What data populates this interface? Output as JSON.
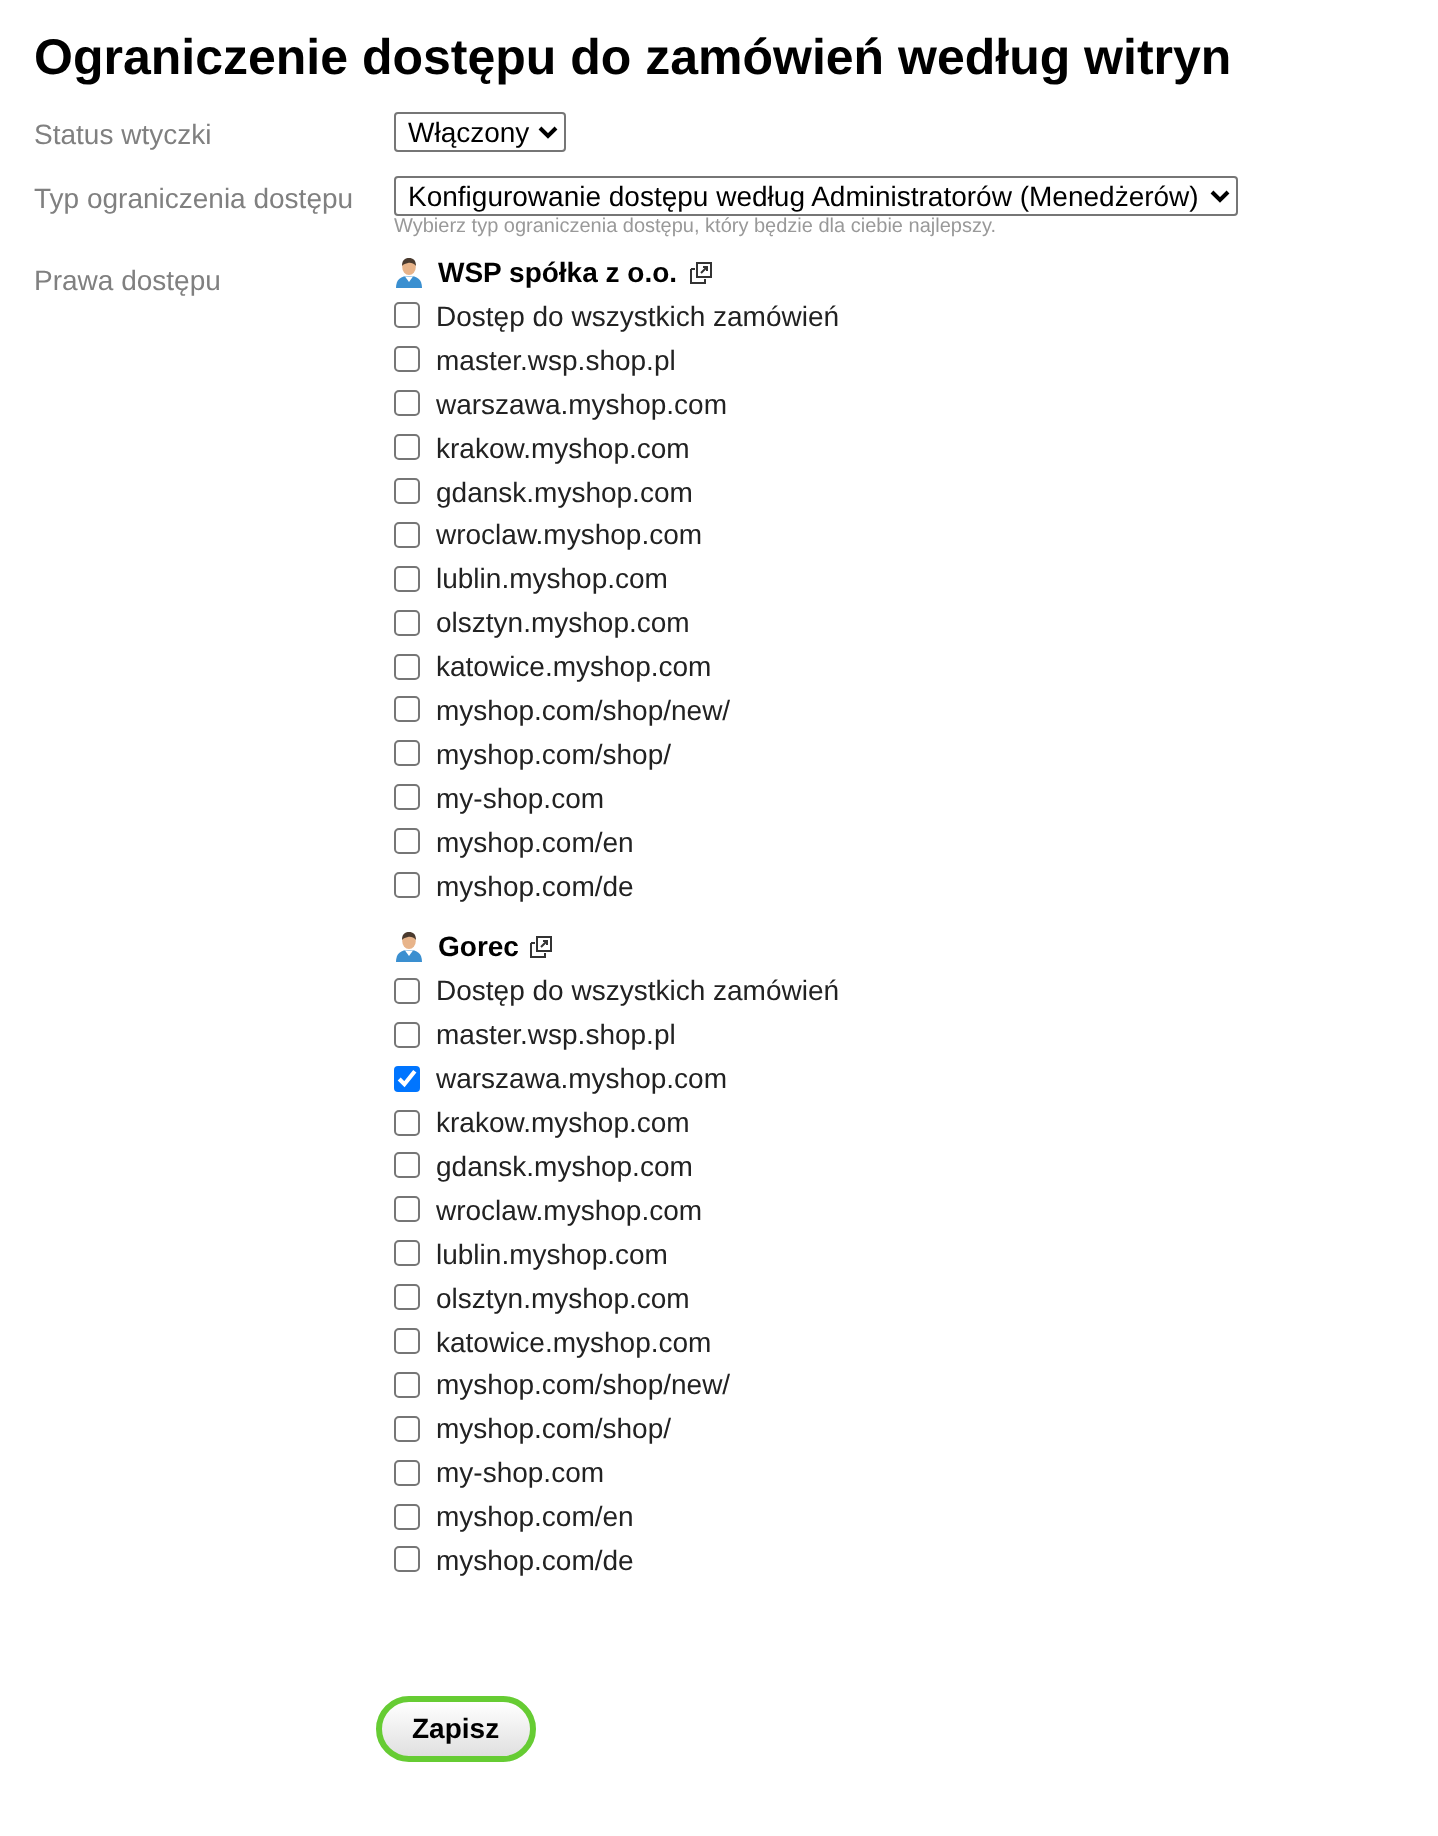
{
  "title": "Ograniczenie dostępu do zamówień według witryn",
  "fields": [
    {
      "label": "Status wtyczki",
      "value": "Włączony"
    },
    {
      "label": "Typ ograniczenia dostępu",
      "value": "Konfigurowanie dostępu według Administratorów (Menedżerów)",
      "hint": "Wybierz typ ograniczenia dostępu, który będzie dla ciebie najlepszy."
    }
  ],
  "access": {
    "label": "Prawa dostępu",
    "groups": [
      {
        "name": "WSP spółka z o.o.",
        "items": [
          {
            "label": "Dostęp do wszystkich zamówień",
            "checked": false
          },
          {
            "label": "master.wsp.shop.pl",
            "checked": false
          },
          {
            "label": "warszawa.myshop.com",
            "checked": false
          },
          {
            "label": "krakow.myshop.com",
            "checked": false
          },
          {
            "label": "gdansk.myshop.com",
            "checked": false
          },
          {
            "label": "wroclaw.myshop.com",
            "checked": false
          },
          {
            "label": "lublin.myshop.com",
            "checked": false
          },
          {
            "label": "olsztyn.myshop.com",
            "checked": false
          },
          {
            "label": "katowice.myshop.com",
            "checked": false
          },
          {
            "label": "myshop.com/shop/new/",
            "checked": false
          },
          {
            "label": "myshop.com/shop/",
            "checked": false
          },
          {
            "label": "my-shop.com",
            "checked": false
          },
          {
            "label": "myshop.com/en",
            "checked": false
          },
          {
            "label": "myshop.com/de",
            "checked": false
          }
        ]
      },
      {
        "name": "Gorec",
        "items": [
          {
            "label": "Dostęp do wszystkich zamówień",
            "checked": false
          },
          {
            "label": "master.wsp.shop.pl",
            "checked": false
          },
          {
            "label": "warszawa.myshop.com",
            "checked": true
          },
          {
            "label": "krakow.myshop.com",
            "checked": false
          },
          {
            "label": "gdansk.myshop.com",
            "checked": false
          },
          {
            "label": "wroclaw.myshop.com",
            "checked": false
          },
          {
            "label": "lublin.myshop.com",
            "checked": false
          },
          {
            "label": "olsztyn.myshop.com",
            "checked": false
          },
          {
            "label": "katowice.myshop.com",
            "checked": false
          },
          {
            "label": "myshop.com/shop/new/",
            "checked": false
          },
          {
            "label": "myshop.com/shop/",
            "checked": false
          },
          {
            "label": "my-shop.com",
            "checked": false
          },
          {
            "label": "myshop.com/en",
            "checked": false
          },
          {
            "label": "myshop.com/de",
            "checked": false
          }
        ]
      }
    ]
  },
  "save_button": "Zapisz"
}
